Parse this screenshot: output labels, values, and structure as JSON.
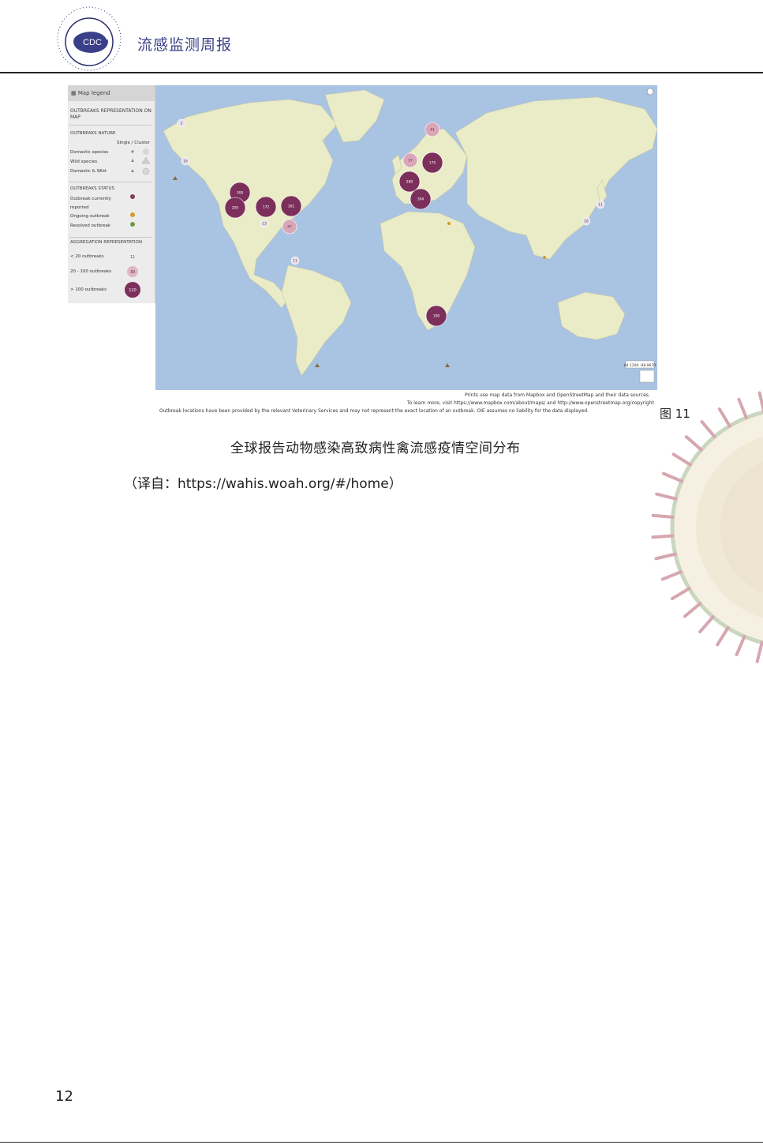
{
  "header": {
    "title": "流感监测周报",
    "logo_text": "CDC"
  },
  "figure": {
    "legend": {
      "title": "Map legend",
      "heading": "OUTBREAKS REPRESENTATION ON MAP",
      "nature_label": "OUTBREAKS NATURE",
      "single_cluster": "Single / Cluster",
      "nature_items": [
        "Domestic species",
        "Wild species",
        "Domestic & Wild"
      ],
      "status_label": "OUTBREAKS STATUS",
      "status_items": [
        "Outbreak currently reported",
        "Ongoing outbreak",
        "Resolved outbreak"
      ],
      "status_colors": [
        "#8b3a5c",
        "#d59a2b",
        "#6f9b3f"
      ],
      "aggregation_label": "AGGREGATION REPRESENTATION",
      "aggregation_items": [
        "< 20 outbreaks",
        "20 - 100 outbreaks",
        "> 100 outbreaks"
      ],
      "aggregation_samples": [
        "11",
        "30",
        "120"
      ]
    },
    "clusters": [
      {
        "label": "2",
        "size": "small"
      },
      {
        "label": "16",
        "size": "small"
      },
      {
        "label": "300",
        "size": "large"
      },
      {
        "label": "205",
        "size": "large"
      },
      {
        "label": "172",
        "size": "large"
      },
      {
        "label": "161",
        "size": "large"
      },
      {
        "label": "13",
        "size": "small"
      },
      {
        "label": "47",
        "size": "medium"
      },
      {
        "label": "11",
        "size": "small"
      },
      {
        "label": "41",
        "size": "medium"
      },
      {
        "label": "37",
        "size": "medium"
      },
      {
        "label": "175",
        "size": "large"
      },
      {
        "label": "280",
        "size": "large"
      },
      {
        "label": "304",
        "size": "large"
      },
      {
        "label": "11",
        "size": "small"
      },
      {
        "label": "16",
        "size": "small"
      },
      {
        "label": "190",
        "size": "large"
      }
    ],
    "coords_readout": "84.1290 -98.9670",
    "attribution": [
      "Prints use map data from Mapbox and OpenStreetMap and their data sources.",
      "To learn more, visit https://www.mapbox.com/about/maps/ and http://www.openstreetmap.org/copyright",
      "Outbreak locations have been provided by the relevant Veterinary Services and may not represent the exact location of an outbreak. OIE assumes no liability for the data displayed."
    ],
    "label": "图 11"
  },
  "caption": "全球报告动物感染高致病性禽流感疫情空间分布",
  "source": "（译自：https://wahis.woah.org/#/home）",
  "page_number": "12",
  "colors": {
    "ocean": "#a9c3e2",
    "land": "#e9ecc7",
    "cluster_large": "#7d2f5c",
    "cluster_medium": "#d9a7b8",
    "cluster_small": "#e8e1ea",
    "header_text": "#3b3f86"
  }
}
